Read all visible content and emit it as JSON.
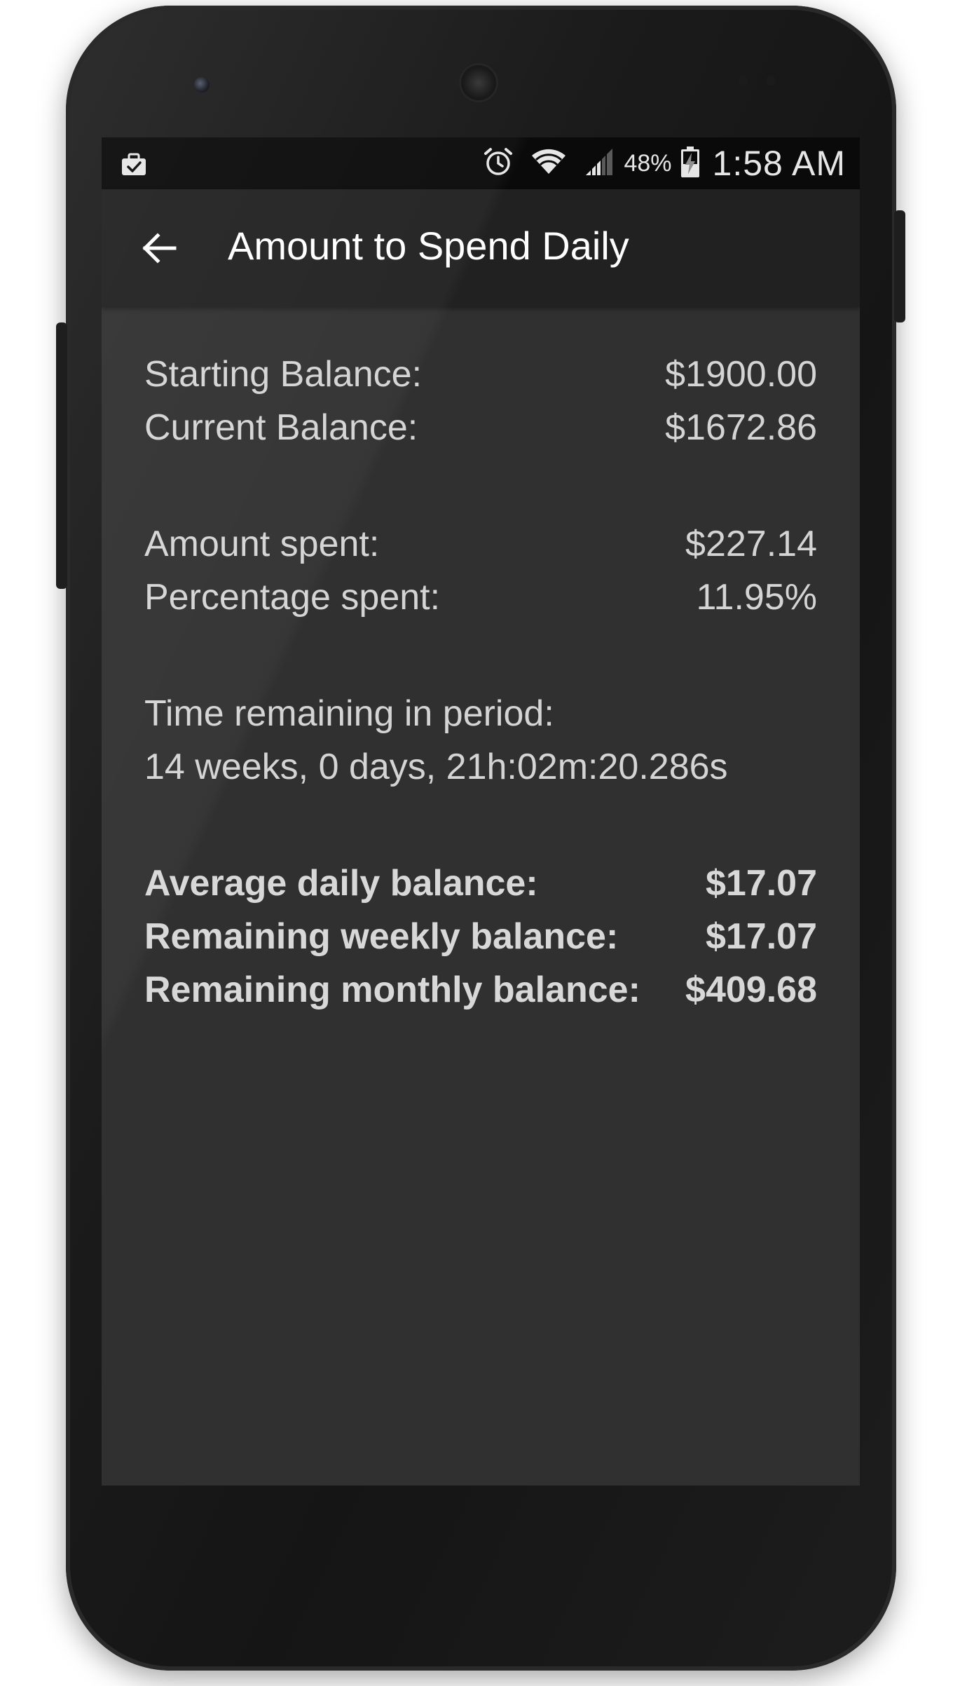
{
  "status_bar": {
    "notification_icon": "briefcase-check-icon",
    "icons": [
      "alarm-icon",
      "wifi-icon",
      "cell-signal-icon"
    ],
    "battery_percent": "48%",
    "battery_icon": "battery-charging-icon",
    "time": "1:58 AM"
  },
  "app_bar": {
    "back_icon": "arrow-back-icon",
    "title": "Amount to Spend Daily"
  },
  "balances": {
    "starting_label": "Starting Balance:",
    "starting_value": "$1900.00",
    "current_label": "Current Balance:",
    "current_value": "$1672.86"
  },
  "spending": {
    "amount_label": "Amount spent:",
    "amount_value": "$227.14",
    "percentage_label": "Percentage spent:",
    "percentage_value": "11.95%"
  },
  "period": {
    "label": "Time remaining in period:",
    "value": "14 weeks, 0 days, 21h:02m:20.286s"
  },
  "summary": {
    "daily_label": "Average daily balance:",
    "daily_value": "$17.07",
    "weekly_label": "Remaining weekly balance:",
    "weekly_value": "$17.07",
    "monthly_label": "Remaining monthly balance:",
    "monthly_value": "$409.68"
  },
  "colors": {
    "screen_bg": "#303030",
    "app_bar_bg": "#212121",
    "status_bar_bg": "#0a0a0a",
    "text": "#d4d4d4",
    "title_text": "#ffffff"
  }
}
